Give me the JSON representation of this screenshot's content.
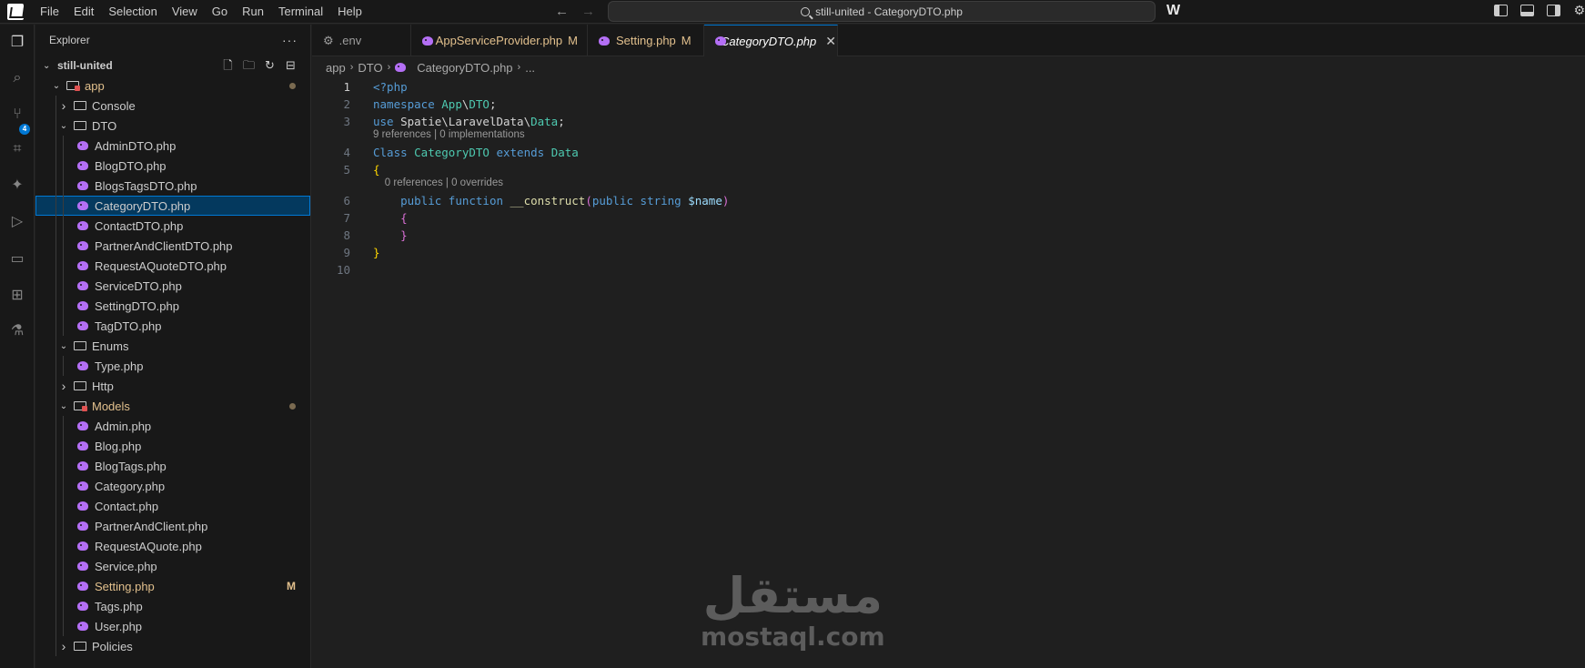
{
  "menu": [
    "File",
    "Edit",
    "Selection",
    "View",
    "Go",
    "Run",
    "Terminal",
    "Help"
  ],
  "search": {
    "text": "still-united - CategoryDTO.php"
  },
  "explorer": {
    "title": "Explorer",
    "project": "still-united",
    "tree": [
      {
        "label": "app",
        "kind": "folder-open",
        "depth": 1,
        "status": "dot",
        "tone": "mod"
      },
      {
        "label": "Console",
        "kind": "folder-closed",
        "depth": 2
      },
      {
        "label": "DTO",
        "kind": "folder-open",
        "depth": 2
      },
      {
        "label": "AdminDTO.php",
        "kind": "php",
        "depth": 3
      },
      {
        "label": "BlogDTO.php",
        "kind": "php",
        "depth": 3
      },
      {
        "label": "BlogsTagsDTO.php",
        "kind": "php",
        "depth": 3
      },
      {
        "label": "CategoryDTO.php",
        "kind": "php",
        "depth": 3,
        "selected": true
      },
      {
        "label": "ContactDTO.php",
        "kind": "php",
        "depth": 3
      },
      {
        "label": "PartnerAndClientDTO.php",
        "kind": "php",
        "depth": 3
      },
      {
        "label": "RequestAQuoteDTO.php",
        "kind": "php",
        "depth": 3
      },
      {
        "label": "ServiceDTO.php",
        "kind": "php",
        "depth": 3
      },
      {
        "label": "SettingDTO.php",
        "kind": "php",
        "depth": 3
      },
      {
        "label": "TagDTO.php",
        "kind": "php",
        "depth": 3
      },
      {
        "label": "Enums",
        "kind": "folder-open",
        "depth": 2
      },
      {
        "label": "Type.php",
        "kind": "php",
        "depth": 3
      },
      {
        "label": "Http",
        "kind": "folder-closed",
        "depth": 2
      },
      {
        "label": "Models",
        "kind": "folder-open",
        "depth": 2,
        "status": "dot",
        "tone": "mod"
      },
      {
        "label": "Admin.php",
        "kind": "php",
        "depth": 3
      },
      {
        "label": "Blog.php",
        "kind": "php",
        "depth": 3
      },
      {
        "label": "BlogTags.php",
        "kind": "php",
        "depth": 3
      },
      {
        "label": "Category.php",
        "kind": "php",
        "depth": 3
      },
      {
        "label": "Contact.php",
        "kind": "php",
        "depth": 3
      },
      {
        "label": "PartnerAndClient.php",
        "kind": "php",
        "depth": 3
      },
      {
        "label": "RequestAQuote.php",
        "kind": "php",
        "depth": 3
      },
      {
        "label": "Service.php",
        "kind": "php",
        "depth": 3
      },
      {
        "label": "Setting.php",
        "kind": "php",
        "depth": 3,
        "status": "M",
        "tone": "mod"
      },
      {
        "label": "Tags.php",
        "kind": "php",
        "depth": 3
      },
      {
        "label": "User.php",
        "kind": "php",
        "depth": 3
      },
      {
        "label": "Policies",
        "kind": "folder-closed",
        "depth": 2
      }
    ]
  },
  "tabs": [
    {
      "label": ".env",
      "icon": "gear-icon",
      "modified": "",
      "active": false
    },
    {
      "label": "AppServiceProvider.php",
      "icon": "php-icon",
      "modified": "M",
      "active": false
    },
    {
      "label": "Setting.php",
      "icon": "php-icon",
      "modified": "M",
      "active": false
    },
    {
      "label": "CategoryDTO.php",
      "icon": "php-icon",
      "modified": "",
      "active": true
    }
  ],
  "breadcrumb": [
    "app",
    "DTO",
    "CategoryDTO.php",
    "..."
  ],
  "editor": {
    "lines": [
      {
        "n": "1",
        "tokens": [
          [
            "tag",
            "<?php"
          ]
        ]
      },
      {
        "n": "2",
        "tokens": [
          [
            "k",
            "namespace "
          ],
          [
            "t",
            "App"
          ],
          [
            "p",
            "\\"
          ],
          [
            "t",
            "DTO"
          ],
          [
            "p",
            ";"
          ]
        ]
      },
      {
        "n": "3",
        "tokens": [
          [
            "k",
            "use "
          ],
          [
            "p",
            "Spatie\\LaravelData\\"
          ],
          [
            "t",
            "Data"
          ],
          [
            "p",
            ";"
          ]
        ]
      },
      {
        "lens": "9 references | 0 implementations"
      },
      {
        "n": "4",
        "tokens": [
          [
            "k",
            "Class "
          ],
          [
            "t",
            "CategoryDTO "
          ],
          [
            "k",
            "extends "
          ],
          [
            "t",
            "Data"
          ]
        ]
      },
      {
        "n": "5",
        "tokens": [
          [
            "b1",
            "{"
          ]
        ]
      },
      {
        "lens": "    0 references | 0 overrides"
      },
      {
        "n": "6",
        "tokens": [
          [
            "p",
            "    "
          ],
          [
            "k",
            "public "
          ],
          [
            "k",
            "function "
          ],
          [
            "f",
            "__construct"
          ],
          [
            "b2",
            "("
          ],
          [
            "k",
            "public "
          ],
          [
            "k",
            "string "
          ],
          [
            "v",
            "$name"
          ],
          [
            "b2",
            ")"
          ]
        ]
      },
      {
        "n": "7",
        "tokens": [
          [
            "p",
            "    "
          ],
          [
            "b2",
            "{"
          ]
        ]
      },
      {
        "n": "8",
        "tokens": [
          [
            "p",
            "    "
          ],
          [
            "b2",
            "}"
          ]
        ]
      },
      {
        "n": "9",
        "tokens": [
          [
            "b1",
            "}"
          ]
        ]
      },
      {
        "n": "10",
        "tokens": []
      }
    ]
  },
  "activity_badge": "4",
  "watermark": {
    "arabic": "مستقل",
    "latin": "mostaql.com"
  }
}
